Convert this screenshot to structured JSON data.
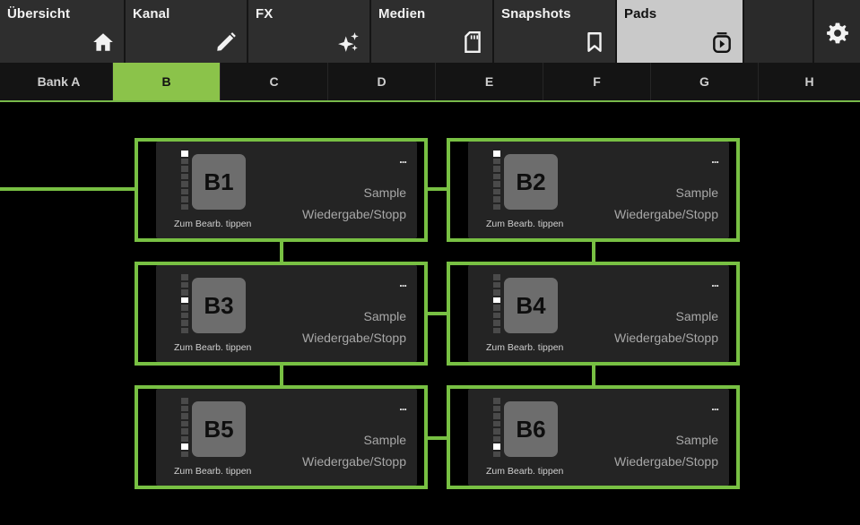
{
  "nav": {
    "tabs": [
      {
        "label": "Übersicht",
        "icon": "home-icon"
      },
      {
        "label": "Kanal",
        "icon": "pencil-icon"
      },
      {
        "label": "FX",
        "icon": "sparkle-icon"
      },
      {
        "label": "Medien",
        "icon": "sd-card-icon"
      },
      {
        "label": "Snapshots",
        "icon": "bookmark-icon"
      },
      {
        "label": "Pads",
        "icon": "pads-icon",
        "active": true
      }
    ],
    "settings_icon": "gear-icon"
  },
  "banks": [
    "Bank A",
    "B",
    "C",
    "D",
    "E",
    "F",
    "G",
    "H"
  ],
  "active_bank": "B",
  "pads": [
    {
      "name": "B1",
      "sample_label": "Sample",
      "action_label": "Wiedergabe/Stopp",
      "edit_hint": "Zum Bearb. tippen",
      "menu": "...",
      "meter_level": 1.0
    },
    {
      "name": "B2",
      "sample_label": "Sample",
      "action_label": "Wiedergabe/Stopp",
      "edit_hint": "Zum Bearb. tippen",
      "menu": "...",
      "meter_level": 1.0
    },
    {
      "name": "B3",
      "sample_label": "Sample",
      "action_label": "Wiedergabe/Stopp",
      "edit_hint": "Zum Bearb. tippen",
      "menu": "...",
      "meter_level": 0.6
    },
    {
      "name": "B4",
      "sample_label": "Sample",
      "action_label": "Wiedergabe/Stopp",
      "edit_hint": "Zum Bearb. tippen",
      "menu": "...",
      "meter_level": 0.6
    },
    {
      "name": "B5",
      "sample_label": "Sample",
      "action_label": "Wiedergabe/Stopp",
      "edit_hint": "Zum Bearb. tippen",
      "menu": "...",
      "meter_level": 0.2
    },
    {
      "name": "B6",
      "sample_label": "Sample",
      "action_label": "Wiedergabe/Stopp",
      "edit_hint": "Zum Bearb. tippen",
      "menu": "...",
      "meter_level": 0.2
    }
  ],
  "colors": {
    "accent": "#8bc34a",
    "highlight_border": "#78c043",
    "background": "#000000",
    "pad_card": "#242424"
  }
}
